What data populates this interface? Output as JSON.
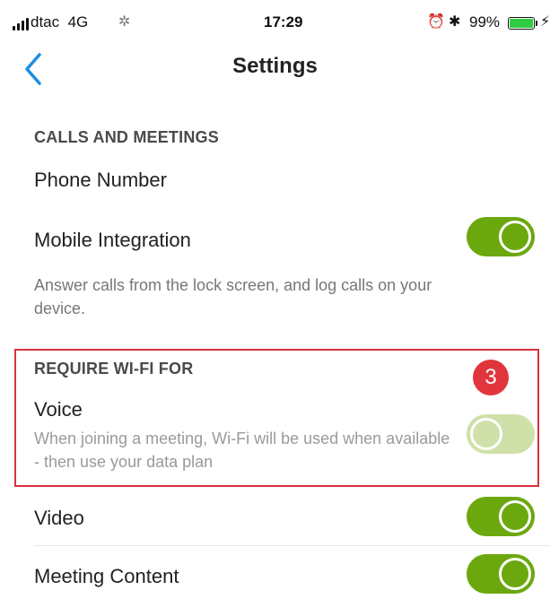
{
  "status_bar": {
    "carrier": "dtac",
    "network": "4G",
    "activity_icon": "loading-icon",
    "time": "17:29",
    "battery_percent": "99%",
    "icons": [
      "signal-icon",
      "alarm-icon",
      "bluetooth-icon",
      "battery-icon",
      "charging-icon"
    ]
  },
  "nav": {
    "title": "Settings",
    "back_icon": "chevron-left-icon",
    "accent_color": "#1a8fe0"
  },
  "calls_section": {
    "header": "CALLS AND MEETINGS",
    "phone_number_label": "Phone Number",
    "mobile_integration_label": "Mobile Integration",
    "mobile_integration_enabled": true,
    "mobile_integration_desc": "Answer calls from the lock screen, and log calls on your device."
  },
  "wifi_section": {
    "header": "REQUIRE WI-FI FOR",
    "callout_number": "3",
    "voice_label": "Voice",
    "voice_desc": "When joining a meeting, Wi-Fi will be used when available - then use your data plan",
    "voice_enabled": false,
    "video_label": "Video",
    "video_enabled": true,
    "meeting_content_label": "Meeting Content",
    "meeting_content_enabled": true
  },
  "colors": {
    "toggle_on": "#6ba80e",
    "toggle_off": "#cfe0a8",
    "highlight": "#d6323d"
  }
}
